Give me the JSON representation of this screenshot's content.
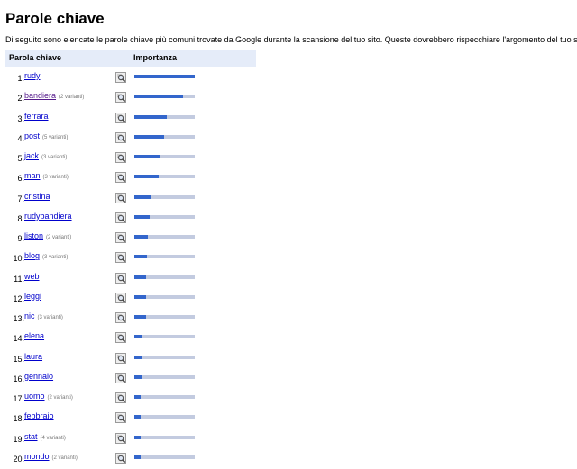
{
  "page": {
    "title": "Parole chiave",
    "description": "Di seguito sono elencate le parole chiave più comuni trovate da Google durante la scansione del tuo sito. Queste dovrebbero rispecchiare l'argomento del tuo sito."
  },
  "table": {
    "header_keyword": "Parola chiave",
    "header_importance": "Importanza",
    "rows": [
      {
        "rank": "1.",
        "keyword": "rudy",
        "variants": "",
        "importance": 1.0,
        "visited": false
      },
      {
        "rank": "2.",
        "keyword": "bandiera",
        "variants": "(2 varianti)",
        "importance": 0.8,
        "visited": true
      },
      {
        "rank": "3.",
        "keyword": "ferrara",
        "variants": "",
        "importance": 0.53,
        "visited": false
      },
      {
        "rank": "4.",
        "keyword": "post",
        "variants": "(5 varianti)",
        "importance": 0.49,
        "visited": false
      },
      {
        "rank": "5.",
        "keyword": "jack",
        "variants": "(3 varianti)",
        "importance": 0.43,
        "visited": false
      },
      {
        "rank": "6.",
        "keyword": "man",
        "variants": "(3 varianti)",
        "importance": 0.4,
        "visited": false
      },
      {
        "rank": "7.",
        "keyword": "cristina",
        "variants": "",
        "importance": 0.28,
        "visited": false
      },
      {
        "rank": "8.",
        "keyword": "rudybandiera",
        "variants": "",
        "importance": 0.26,
        "visited": false
      },
      {
        "rank": "9.",
        "keyword": "liston",
        "variants": "(2 varianti)",
        "importance": 0.22,
        "visited": false
      },
      {
        "rank": "10.",
        "keyword": "blog",
        "variants": "(3 varianti)",
        "importance": 0.21,
        "visited": false
      },
      {
        "rank": "11.",
        "keyword": "web",
        "variants": "",
        "importance": 0.2,
        "visited": false
      },
      {
        "rank": "12.",
        "keyword": "leggi",
        "variants": "",
        "importance": 0.2,
        "visited": false
      },
      {
        "rank": "13.",
        "keyword": "nic",
        "variants": "(3 varianti)",
        "importance": 0.19,
        "visited": false
      },
      {
        "rank": "14.",
        "keyword": "elena",
        "variants": "",
        "importance": 0.13,
        "visited": false
      },
      {
        "rank": "15.",
        "keyword": "laura",
        "variants": "",
        "importance": 0.13,
        "visited": false
      },
      {
        "rank": "16.",
        "keyword": "gennaio",
        "variants": "",
        "importance": 0.13,
        "visited": false
      },
      {
        "rank": "17.",
        "keyword": "uomo",
        "variants": "(2 varianti)",
        "importance": 0.1,
        "visited": false
      },
      {
        "rank": "18.",
        "keyword": "febbraio",
        "variants": "",
        "importance": 0.1,
        "visited": false
      },
      {
        "rank": "19.",
        "keyword": "stat",
        "variants": "(4 varianti)",
        "importance": 0.1,
        "visited": false
      },
      {
        "rank": "20.",
        "keyword": "mondo",
        "variants": "(2 varianti)",
        "importance": 0.1,
        "visited": false
      }
    ]
  },
  "icons": {
    "row_action": "magnifier-icon"
  },
  "colors": {
    "header_bg": "#e5ecf9",
    "bar_fill": "#3366cc",
    "bar_track": "#c3cbe0",
    "link": "#0000cc",
    "visited_link": "#551a8b"
  }
}
